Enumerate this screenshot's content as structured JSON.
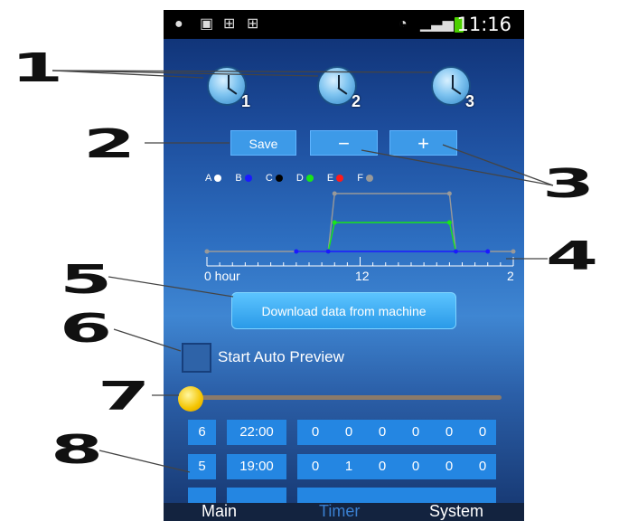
{
  "callouts": [
    "1",
    "2",
    "3",
    "4",
    "5",
    "6",
    "7",
    "8"
  ],
  "status_bar": {
    "time": "11:16",
    "left_icons": [
      "chat-icon",
      "image-icon",
      "briefcase-icon",
      "briefcase-icon"
    ]
  },
  "timers": [
    {
      "label": "1"
    },
    {
      "label": "2"
    },
    {
      "label": "3"
    }
  ],
  "buttons": {
    "save": "Save",
    "minus": "−",
    "plus": "+"
  },
  "legend": [
    {
      "label": "A",
      "color": "#ffffff"
    },
    {
      "label": "B",
      "color": "#1a1aff"
    },
    {
      "label": "C",
      "color": "#000000"
    },
    {
      "label": "D",
      "color": "#19e619"
    },
    {
      "label": "E",
      "color": "#ff1a1a"
    },
    {
      "label": "F",
      "color": "#999999"
    }
  ],
  "chart_data": {
    "type": "line",
    "x_tick_labels": [
      "0 hour",
      "12",
      "2"
    ],
    "series": [
      {
        "color": "#999999",
        "x": [
          0,
          9.5,
          10,
          19,
          19.5,
          24
        ],
        "y": [
          0,
          0,
          100,
          100,
          0,
          0
        ]
      },
      {
        "color": "#19e619",
        "x": [
          9.5,
          10,
          19,
          19.5
        ],
        "y": [
          0,
          50,
          50,
          0
        ]
      },
      {
        "color": "#1a1aff",
        "x": [
          7,
          9.5,
          19.5,
          22
        ],
        "y": [
          0,
          0,
          0,
          0
        ]
      }
    ],
    "xlim": [
      0,
      24
    ],
    "ylim": [
      0,
      100
    ]
  },
  "download_button": "Download data from machine",
  "auto_preview_label": "Start Auto Preview",
  "table_rows": [
    {
      "index": "6",
      "time": "22:00",
      "values": [
        "0",
        "0",
        "0",
        "0",
        "0",
        "0"
      ]
    },
    {
      "index": "5",
      "time": "19:00",
      "values": [
        "0",
        "1",
        "0",
        "0",
        "0",
        "0"
      ]
    }
  ],
  "tabs": [
    {
      "label": "Main",
      "active": false
    },
    {
      "label": "Timer",
      "active": true
    },
    {
      "label": "System",
      "active": false
    }
  ],
  "colors": {
    "active_tab": "#3a7fd0",
    "inactive_tab": "#ffffff",
    "button": "#3d9ae8"
  }
}
